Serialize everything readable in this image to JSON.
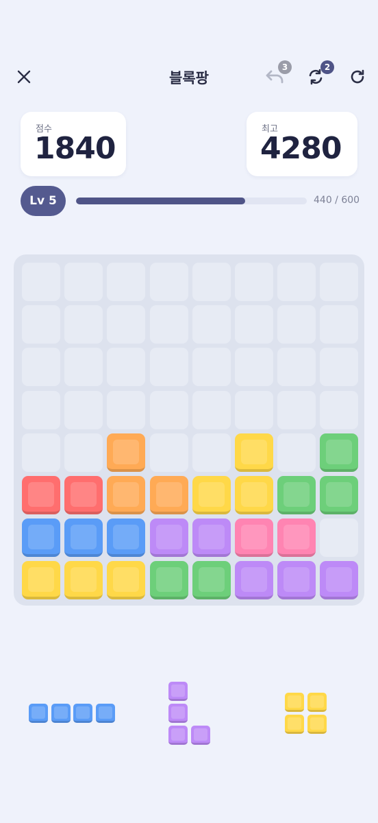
{
  "header": {
    "title": "블록팡",
    "undo_count": "3",
    "swap_count": "2"
  },
  "scores": {
    "score_label": "점수",
    "score_value": "1840",
    "best_label": "최고",
    "best_value": "4280"
  },
  "level": {
    "label": "Lv 5",
    "progress_text": "440 / 600",
    "progress_fraction": 0.7333
  },
  "colors": {
    "orange": "#ffaa55",
    "yellow": "#ffd848",
    "green": "#6dcf7a",
    "red": "#ff6e6e",
    "blue": "#5a9cf7",
    "purple": "#bd8af7",
    "pink": "#ff84b2",
    "accent": "#545a8f"
  },
  "board": {
    "rows": [
      [
        null,
        null,
        null,
        null,
        null,
        null,
        null,
        null
      ],
      [
        null,
        null,
        null,
        null,
        null,
        null,
        null,
        null
      ],
      [
        null,
        null,
        null,
        null,
        null,
        null,
        null,
        null
      ],
      [
        null,
        null,
        null,
        null,
        null,
        null,
        null,
        null
      ],
      [
        null,
        null,
        "orange",
        null,
        null,
        "yellow",
        null,
        "green"
      ],
      [
        "red",
        "red",
        "orange",
        "orange",
        "yellow",
        "yellow",
        "green",
        "green"
      ],
      [
        "blue",
        "blue",
        "blue",
        "purple",
        "purple",
        "pink",
        "pink",
        null
      ],
      [
        "yellow",
        "yellow",
        "yellow",
        "green",
        "green",
        "purple",
        "purple",
        "purple"
      ]
    ]
  },
  "tray": [
    {
      "name": "piece-i-horizontal",
      "color": "blue",
      "cells": [
        [
          0,
          0
        ],
        [
          0,
          1
        ],
        [
          0,
          2
        ],
        [
          0,
          3
        ]
      ]
    },
    {
      "name": "piece-l",
      "color": "purple",
      "cells": [
        [
          0,
          0
        ],
        [
          1,
          0
        ],
        [
          2,
          0
        ],
        [
          2,
          1
        ]
      ]
    },
    {
      "name": "piece-square",
      "color": "yellow",
      "cells": [
        [
          0,
          0
        ],
        [
          0,
          1
        ],
        [
          1,
          0
        ],
        [
          1,
          1
        ]
      ]
    }
  ]
}
